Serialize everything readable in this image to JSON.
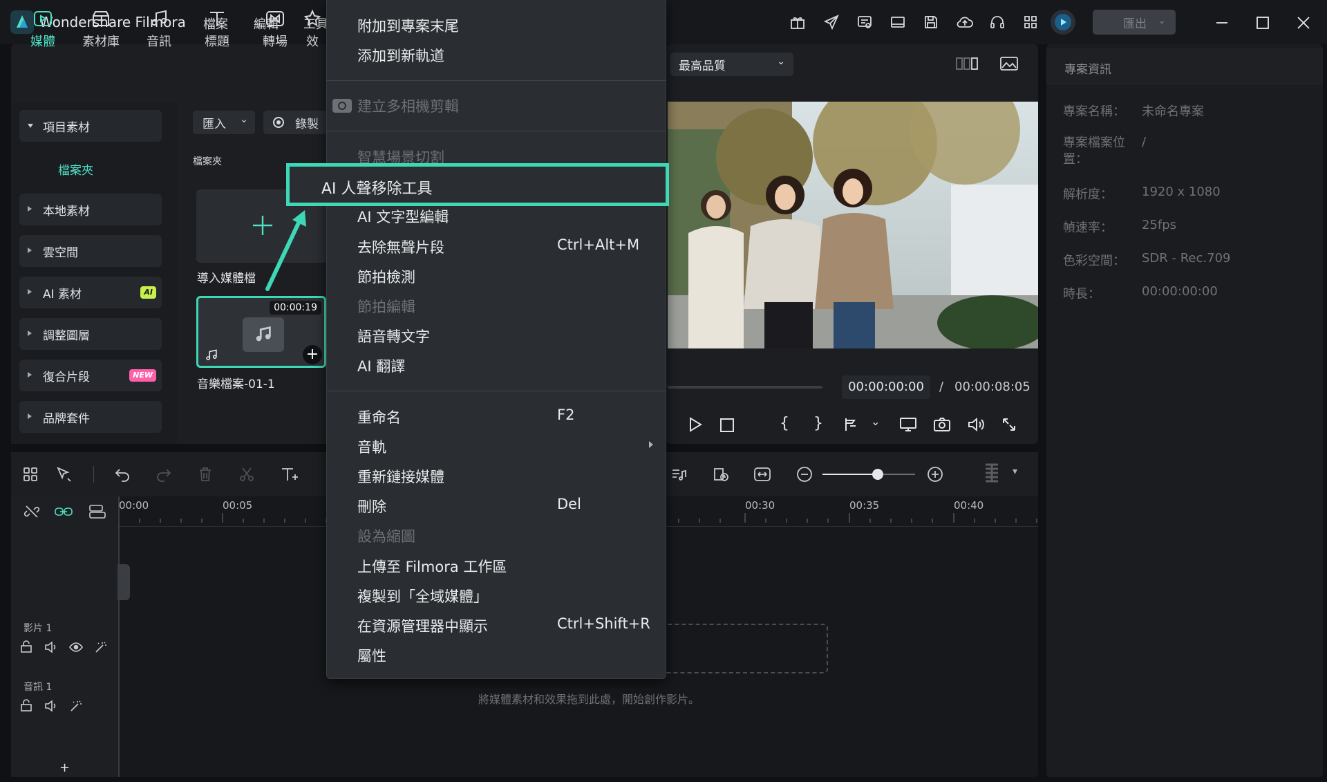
{
  "app": {
    "name": "Wondershare Filmora"
  },
  "menubar": [
    "檔案",
    "編輯",
    "工具"
  ],
  "export_button": "匯出",
  "media_tabs": [
    {
      "label": "媒體",
      "icon": "media-icon"
    },
    {
      "label": "素材庫",
      "icon": "stock-icon"
    },
    {
      "label": "音訊",
      "icon": "music-note-icon"
    },
    {
      "label": "標題",
      "icon": "title-t-icon"
    },
    {
      "label": "轉場",
      "icon": "transition-icon"
    },
    {
      "label": "效",
      "icon": "effects-icon"
    }
  ],
  "sidebar": {
    "items": [
      {
        "label": "項目素材"
      },
      {
        "label": "檔案夾"
      },
      {
        "label": "本地素材"
      },
      {
        "label": "雲空間"
      },
      {
        "label": "AI 素材",
        "badge": "AI"
      },
      {
        "label": "調整圖層"
      },
      {
        "label": "復合片段",
        "badge": "NEW"
      },
      {
        "label": "品牌套件"
      }
    ]
  },
  "media_toolbar": {
    "import": "匯入",
    "record": "錄製"
  },
  "media": {
    "folder_label": "檔案夾",
    "import_tile_label": "導入媒體檔",
    "clip": {
      "duration": "00:00:19",
      "name": "音樂檔案-01-1"
    }
  },
  "context_menu": {
    "items": [
      {
        "label": "附加到專案末尾",
        "disabled": false
      },
      {
        "label": "添加到新軌道",
        "disabled": false
      },
      {
        "label": "建立多相機剪輯",
        "disabled": true
      },
      {
        "label": "智慧場景切割",
        "disabled": true
      },
      {
        "label": "AI 人聲移除工具",
        "disabled": false,
        "highlighted": true
      },
      {
        "label": "AI 文字型編輯",
        "disabled": false
      },
      {
        "label": "去除無聲片段",
        "shortcut": "Ctrl+Alt+M",
        "disabled": false
      },
      {
        "label": "節拍檢測",
        "disabled": false
      },
      {
        "label": "節拍編輯",
        "disabled": true
      },
      {
        "label": "語音轉文字",
        "disabled": false
      },
      {
        "label": "AI 翻譯",
        "disabled": false
      },
      {
        "label": "重命名",
        "shortcut": "F2",
        "disabled": false
      },
      {
        "label": "音軌",
        "submenu": true,
        "disabled": false
      },
      {
        "label": "重新鏈接媒體",
        "disabled": false
      },
      {
        "label": "刪除",
        "shortcut": "Del",
        "disabled": false
      },
      {
        "label": "設為縮圖",
        "disabled": true
      },
      {
        "label": "上傳至 Filmora 工作區",
        "disabled": false
      },
      {
        "label": "複製到「全域媒體」",
        "disabled": false
      },
      {
        "label": "在資源管理器中顯示",
        "shortcut": "Ctrl+Shift+R",
        "disabled": false
      },
      {
        "label": "屬性",
        "disabled": false
      }
    ]
  },
  "preview": {
    "quality": "最高品質",
    "current_time": "00:00:00:00",
    "separator": "/",
    "total_time": "00:00:08:05"
  },
  "project_info": {
    "title": "專案資訊",
    "rows": [
      {
        "label": "專案名稱：",
        "value": "未命名專案"
      },
      {
        "label": "專案檔案位置：",
        "value": "/"
      },
      {
        "label": "解析度：",
        "value": "1920 x 1080"
      },
      {
        "label": "幀速率：",
        "value": "25fps"
      },
      {
        "label": "色彩空間：",
        "value": "SDR - Rec.709"
      },
      {
        "label": "時長：",
        "value": "00:00:00:00"
      }
    ]
  },
  "timeline": {
    "ruler": [
      "00:00",
      "00:05",
      "00:30",
      "00:35",
      "00:40"
    ],
    "tracks": [
      {
        "label": "影片 1"
      },
      {
        "label": "音訊 1"
      }
    ],
    "drop_hint": "將媒體素材和效果拖到此處，開始創作影片。",
    "zoom_level": 0.6
  },
  "colors": {
    "accent": "#4fe0c4",
    "highlight_box": "#3ed8b6",
    "ai_badge": "#c8f04a",
    "new_badge": "#ff5fa8"
  }
}
